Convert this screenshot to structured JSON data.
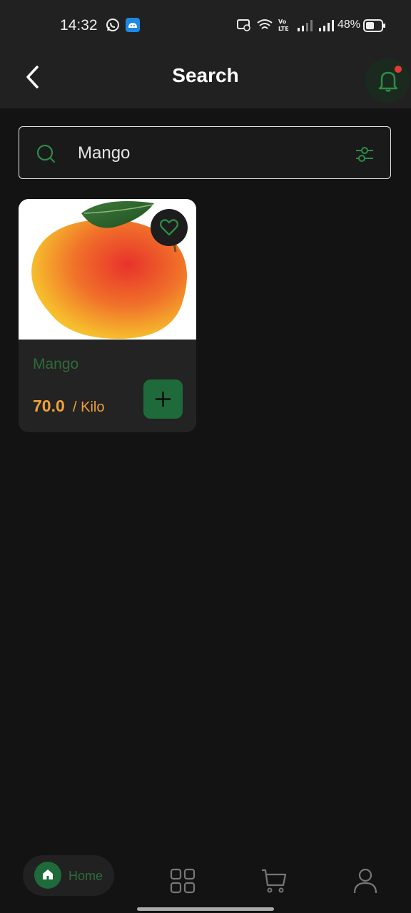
{
  "status_bar": {
    "time": "14:32",
    "battery": "48%",
    "icons": [
      "whatsapp-icon",
      "android-icon",
      "cast-icon",
      "wifi-icon",
      "volte-icon",
      "signal-icon",
      "signal-icon",
      "battery-icon"
    ]
  },
  "header": {
    "title": "Search",
    "back_icon": "chevron-left-icon",
    "notification_icon": "bell-icon",
    "has_unread": true
  },
  "search": {
    "value": "Mango",
    "icon": "search-icon",
    "filter_icon": "sliders-icon"
  },
  "results": [
    {
      "name": "Mango",
      "price": "70.0",
      "unit": "/ Kilo",
      "favorite_icon": "heart-icon",
      "add_icon": "plus-icon"
    }
  ],
  "bottom_nav": {
    "items": [
      {
        "label": "Home",
        "icon": "home-icon",
        "active": true
      },
      {
        "label": "",
        "icon": "grid-icon",
        "active": false
      },
      {
        "label": "",
        "icon": "cart-icon",
        "active": false
      },
      {
        "label": "",
        "icon": "user-icon",
        "active": false
      }
    ]
  },
  "colors": {
    "accent_green": "#1f6a3a",
    "muted_green": "#2e6b3a",
    "price_orange": "#f0a13a",
    "background": "#131313",
    "surface": "#232323"
  }
}
